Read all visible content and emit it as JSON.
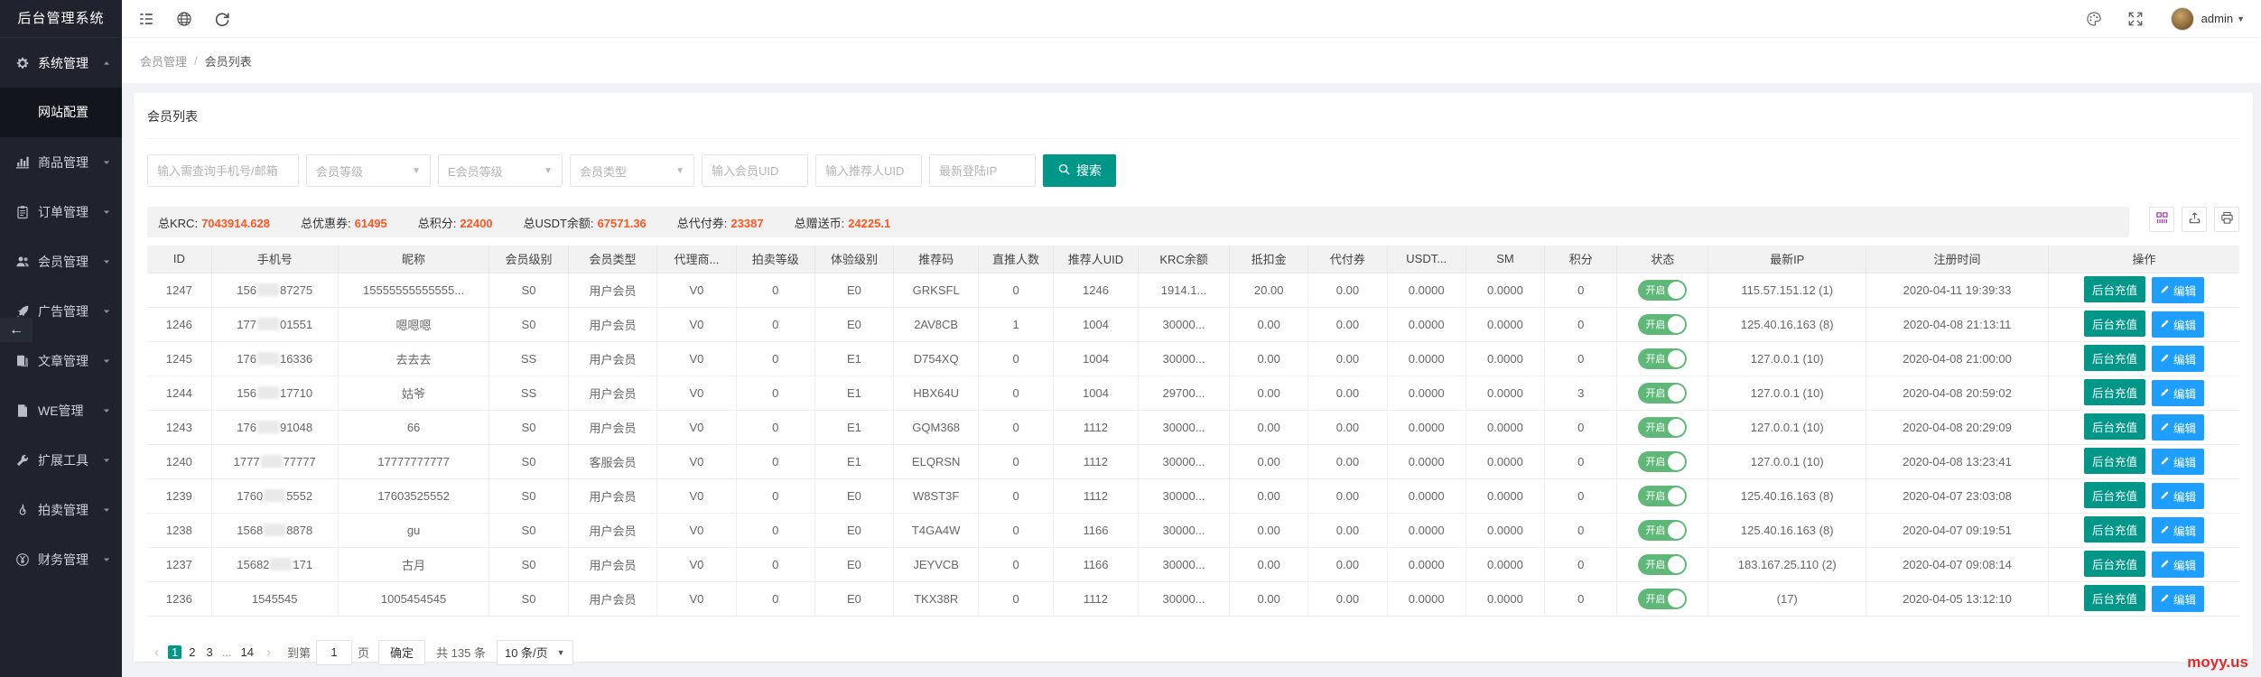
{
  "app": {
    "title": "后台管理系统",
    "user": "admin"
  },
  "sidebar": {
    "collapse_arrow": "←",
    "items": [
      {
        "label": "系统管理",
        "icon": "gear-icon",
        "caret": "up",
        "active": true,
        "submenu": [
          {
            "label": "网站配置",
            "active": true
          }
        ]
      },
      {
        "label": "商品管理",
        "icon": "chart-icon",
        "caret": "down"
      },
      {
        "label": "订单管理",
        "icon": "order-icon",
        "caret": "down"
      },
      {
        "label": "会员管理",
        "icon": "users-icon",
        "caret": "down"
      },
      {
        "label": "广告管理",
        "icon": "rocket-icon",
        "caret": "down"
      },
      {
        "label": "文章管理",
        "icon": "article-icon",
        "caret": "down"
      },
      {
        "label": "WE管理",
        "icon": "file-icon",
        "caret": "down"
      },
      {
        "label": "扩展工具",
        "icon": "wrench-icon",
        "caret": "down"
      },
      {
        "label": "拍卖管理",
        "icon": "fire-icon",
        "caret": "down"
      },
      {
        "label": "财务管理",
        "icon": "yen-icon",
        "caret": "down"
      }
    ]
  },
  "topbar": {
    "left_icons": [
      "menu-toggle-icon",
      "globe-icon",
      "refresh-icon"
    ],
    "right_icons": [
      "palette-icon",
      "fullscreen-icon"
    ]
  },
  "breadcrumb": {
    "parent": "会员管理",
    "sep": "/",
    "current": "会员列表"
  },
  "card": {
    "title": "会员列表"
  },
  "filters": {
    "phone_placeholder": "输入需查询手机号/邮箱",
    "level_label": "会员等级",
    "elevel_label": "E会员等级",
    "type_label": "会员类型",
    "uid_placeholder": "输入会员UID",
    "ref_placeholder": "输入推荐人UID",
    "ip_placeholder": "最新登陆IP",
    "search_label": "搜索"
  },
  "stats": [
    {
      "label": "总KRC:",
      "value": "7043914.628"
    },
    {
      "label": "总优惠券:",
      "value": "61495"
    },
    {
      "label": "总积分:",
      "value": "22400"
    },
    {
      "label": "总USDT余额:",
      "value": "67571.36"
    },
    {
      "label": "总代付券:",
      "value": "23387"
    },
    {
      "label": "总赠送币:",
      "value": "24225.1"
    }
  ],
  "toolbar": {
    "icons": [
      "column-filter-icon",
      "export-icon",
      "print-icon"
    ]
  },
  "table": {
    "columns": [
      "ID",
      "手机号",
      "昵称",
      "会员级别",
      "会员类型",
      "代理商...",
      "拍卖等级",
      "体验级别",
      "推荐码",
      "直推人数",
      "推荐人UID",
      "KRC余额",
      "抵扣金",
      "代付券",
      "USDT...",
      "SM",
      "积分",
      "状态",
      "最新IP",
      "注册时间",
      "操作"
    ],
    "recharge_label": "后台充值",
    "edit_label": "编辑",
    "rows": [
      {
        "id": "1247",
        "phone_prefix": "156",
        "phone_suffix": "87275",
        "masked": true,
        "nickname": "15555555555555...",
        "level": "S0",
        "type": "用户会员",
        "agent": "V0",
        "auction": "0",
        "exp": "E0",
        "code": "GRKSFL",
        "direct": "0",
        "ref_uid": "1246",
        "krc": "1914.1...",
        "deduct": "20.00",
        "voucher": "0.00",
        "usdt": "0.0000",
        "sm": "0.0000",
        "points": "0",
        "status": "开启",
        "ip": "115.57.151.12 (1)",
        "time": "2020-04-11 19:39:33"
      },
      {
        "id": "1246",
        "phone_prefix": "177",
        "phone_suffix": "01551",
        "masked": true,
        "nickname": "嗯嗯嗯",
        "level": "S0",
        "type": "用户会员",
        "agent": "V0",
        "auction": "0",
        "exp": "E0",
        "code": "2AV8CB",
        "direct": "1",
        "ref_uid": "1004",
        "krc": "30000...",
        "deduct": "0.00",
        "voucher": "0.00",
        "usdt": "0.0000",
        "sm": "0.0000",
        "points": "0",
        "status": "开启",
        "ip": "125.40.16.163 (8)",
        "time": "2020-04-08 21:13:11"
      },
      {
        "id": "1245",
        "phone_prefix": "176",
        "phone_suffix": "16336",
        "masked": true,
        "nickname": "去去去",
        "level": "SS",
        "type": "用户会员",
        "agent": "V0",
        "auction": "0",
        "exp": "E1",
        "code": "D754XQ",
        "direct": "0",
        "ref_uid": "1004",
        "krc": "30000...",
        "deduct": "0.00",
        "voucher": "0.00",
        "usdt": "0.0000",
        "sm": "0.0000",
        "points": "0",
        "status": "开启",
        "ip": "127.0.0.1 (10)",
        "time": "2020-04-08 21:00:00"
      },
      {
        "id": "1244",
        "phone_prefix": "156",
        "phone_suffix": "17710",
        "masked": true,
        "nickname": "姑爷",
        "level": "SS",
        "type": "用户会员",
        "agent": "V0",
        "auction": "0",
        "exp": "E1",
        "code": "HBX64U",
        "direct": "0",
        "ref_uid": "1004",
        "krc": "29700...",
        "deduct": "0.00",
        "voucher": "0.00",
        "usdt": "0.0000",
        "sm": "0.0000",
        "points": "3",
        "status": "开启",
        "ip": "127.0.0.1 (10)",
        "time": "2020-04-08 20:59:02"
      },
      {
        "id": "1243",
        "phone_prefix": "176",
        "phone_suffix": "91048",
        "masked": true,
        "nickname": "66",
        "level": "S0",
        "type": "用户会员",
        "agent": "V0",
        "auction": "0",
        "exp": "E1",
        "code": "GQM368",
        "direct": "0",
        "ref_uid": "1112",
        "krc": "30000...",
        "deduct": "0.00",
        "voucher": "0.00",
        "usdt": "0.0000",
        "sm": "0.0000",
        "points": "0",
        "status": "开启",
        "ip": "127.0.0.1 (10)",
        "time": "2020-04-08 20:29:09"
      },
      {
        "id": "1240",
        "phone_prefix": "1777",
        "phone_suffix": "77777",
        "masked": true,
        "nickname": "17777777777",
        "level": "S0",
        "type": "客服会员",
        "agent": "V0",
        "auction": "0",
        "exp": "E1",
        "code": "ELQRSN",
        "direct": "0",
        "ref_uid": "1112",
        "krc": "30000...",
        "deduct": "0.00",
        "voucher": "0.00",
        "usdt": "0.0000",
        "sm": "0.0000",
        "points": "0",
        "status": "开启",
        "ip": "127.0.0.1 (10)",
        "time": "2020-04-08 13:23:41"
      },
      {
        "id": "1239",
        "phone_prefix": "1760",
        "phone_suffix": "5552",
        "masked": true,
        "nickname": "17603525552",
        "level": "S0",
        "type": "用户会员",
        "agent": "V0",
        "auction": "0",
        "exp": "E0",
        "code": "W8ST3F",
        "direct": "0",
        "ref_uid": "1112",
        "krc": "30000...",
        "deduct": "0.00",
        "voucher": "0.00",
        "usdt": "0.0000",
        "sm": "0.0000",
        "points": "0",
        "status": "开启",
        "ip": "125.40.16.163 (8)",
        "time": "2020-04-07 23:03:08"
      },
      {
        "id": "1238",
        "phone_prefix": "1568",
        "phone_suffix": "8878",
        "masked": true,
        "nickname": "gu",
        "level": "S0",
        "type": "用户会员",
        "agent": "V0",
        "auction": "0",
        "exp": "E0",
        "code": "T4GA4W",
        "direct": "0",
        "ref_uid": "1166",
        "krc": "30000...",
        "deduct": "0.00",
        "voucher": "0.00",
        "usdt": "0.0000",
        "sm": "0.0000",
        "points": "0",
        "status": "开启",
        "ip": "125.40.16.163 (8)",
        "time": "2020-04-07 09:19:51"
      },
      {
        "id": "1237",
        "phone_prefix": "15682",
        "phone_suffix": "171",
        "masked": true,
        "nickname": "古月",
        "level": "S0",
        "type": "用户会员",
        "agent": "V0",
        "auction": "0",
        "exp": "E0",
        "code": "JEYVCB",
        "direct": "0",
        "ref_uid": "1166",
        "krc": "30000...",
        "deduct": "0.00",
        "voucher": "0.00",
        "usdt": "0.0000",
        "sm": "0.0000",
        "points": "0",
        "status": "开启",
        "ip": "183.167.25.110 (2)",
        "time": "2020-04-07 09:08:14"
      },
      {
        "id": "1236",
        "phone_prefix": "1545545",
        "phone_suffix": "",
        "masked": false,
        "nickname": "1005454545",
        "level": "S0",
        "type": "用户会员",
        "agent": "V0",
        "auction": "0",
        "exp": "E0",
        "code": "TKX38R",
        "direct": "0",
        "ref_uid": "1112",
        "krc": "30000...",
        "deduct": "0.00",
        "voucher": "0.00",
        "usdt": "0.0000",
        "sm": "0.0000",
        "points": "0",
        "status": "开启",
        "ip": "(17)",
        "time": "2020-04-05 13:12:10"
      }
    ]
  },
  "pagination": {
    "prev": "‹",
    "next": "›",
    "pages": [
      "1",
      "2",
      "3",
      "...",
      "14"
    ],
    "active_page": "1",
    "jump_prefix": "到第",
    "jump_value": "1",
    "jump_suffix": "页",
    "confirm_label": "确定",
    "total_label": "共 135 条",
    "per_page_label": "10 条/页"
  },
  "watermark": "moyy.us",
  "colors": {
    "accent_teal": "#009688",
    "accent_blue": "#1e9fff",
    "toggle_green": "#5fb878",
    "stat_orange": "#ff5722"
  }
}
